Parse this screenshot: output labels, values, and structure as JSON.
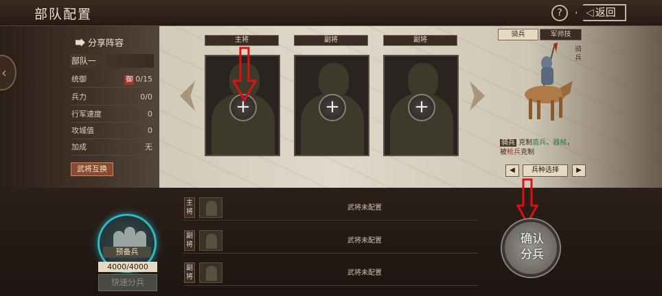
{
  "header": {
    "title": "部队配置",
    "help_label": "?",
    "back_label": "返回"
  },
  "left": {
    "share_label": "分享阵容",
    "troop_name": "部队一",
    "stats": [
      {
        "key": "统御",
        "badge": "御",
        "value": "0/15"
      },
      {
        "key": "兵力",
        "value": "0/0"
      },
      {
        "key": "行军速度",
        "value": "0"
      },
      {
        "key": "攻城值",
        "value": "0"
      },
      {
        "key": "加成",
        "value": "无"
      }
    ],
    "swap_label": "武将互换"
  },
  "slots": [
    {
      "role": "主将",
      "plus": "+"
    },
    {
      "role": "副将",
      "plus": "+"
    },
    {
      "role": "副将",
      "plus": "+"
    }
  ],
  "unit_panel": {
    "tab_cavalry": "骑兵",
    "tab_skill": "军师技",
    "vertical_label": "骑兵",
    "counter_tag": "骑兵",
    "counter_text_1": "克制",
    "counter_spear": "盾兵",
    "counter_sep": "、",
    "counter_siege": "器械",
    "counter_text_2": "，",
    "counter_text_3": "被",
    "counter_by": "枪兵",
    "counter_text_4": "克制",
    "select_label": "兵种选择",
    "prev": "◀",
    "next": "▶"
  },
  "rows": [
    {
      "role": "主将",
      "status": "武将未配置"
    },
    {
      "role": "副将",
      "status": "武将未配置"
    },
    {
      "role": "副将",
      "status": "武将未配置"
    }
  ],
  "reserve": {
    "label": "预备兵",
    "count": "4000/4000",
    "quick_label": "快速分兵"
  },
  "confirm": {
    "label": "确认分兵"
  }
}
